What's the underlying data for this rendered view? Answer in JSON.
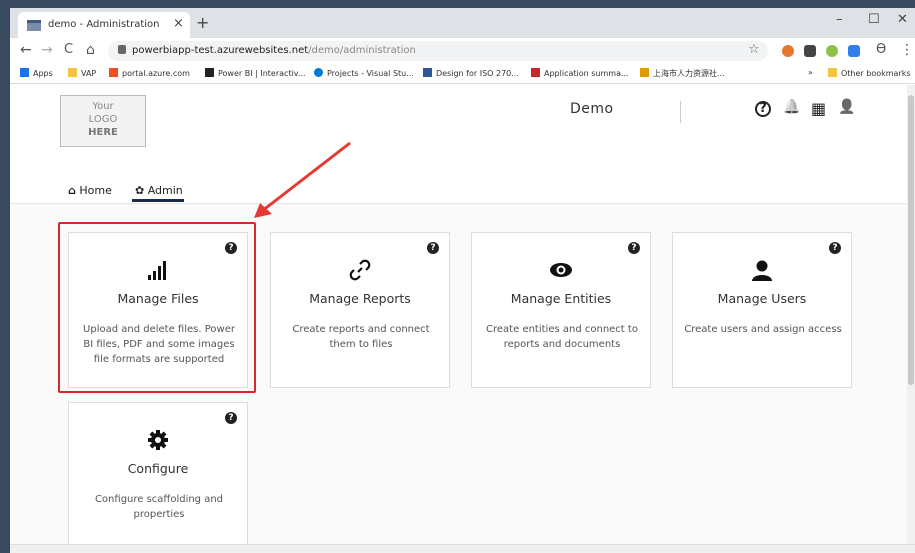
{
  "browser": {
    "tab_title": "demo - Administration",
    "tab_close": "×",
    "new_tab": "+",
    "minimize": "–",
    "maximize": "☐",
    "close": "✕",
    "back": "←",
    "forward": "→",
    "reload": "C",
    "home": "⌂",
    "url_host": "powerbiapp-test.azurewebsites.net",
    "url_path": "/demo/administration",
    "star": "☆",
    "profile": "ϴ",
    "menu": "⋮"
  },
  "bookmarks": {
    "apps": "Apps",
    "items": [
      "VAP",
      "portal.azure.com",
      "Power BI | Interactiv...",
      "Projects - Visual Stu...",
      "Design for ISO 270...",
      "Application summa...",
      "上海市人力资源社..."
    ],
    "more": "»",
    "other": "Other bookmarks"
  },
  "header": {
    "logo_line1": "Your",
    "logo_line2": "LOGO",
    "logo_line3": "HERE",
    "title": "Demo",
    "help_icon": "?",
    "bell_icon": "🔔",
    "apps_icon": "▦",
    "user_icon": "👤"
  },
  "nav": {
    "home": "Home",
    "admin": "Admin",
    "home_icon": "⌂",
    "admin_icon": "✿"
  },
  "cards": [
    {
      "title": "Manage Files",
      "desc": "Upload and delete files. Power BI files, PDF and some images file formats are supported",
      "icon": "bar-chart-icon"
    },
    {
      "title": "Manage Reports",
      "desc": "Create reports and connect them to files",
      "icon": "link-icon"
    },
    {
      "title": "Manage Entities",
      "desc": "Create entities and connect to reports and documents",
      "icon": "eye-icon"
    },
    {
      "title": "Manage Users",
      "desc": "Create users and assign access",
      "icon": "user-icon"
    },
    {
      "title": "Configure",
      "desc": "Configure scaffolding and properties",
      "icon": "gear-icon"
    }
  ],
  "card_help": "?",
  "colors": {
    "highlight": "#d9262c",
    "nav_underline": "#1a2b4c"
  }
}
